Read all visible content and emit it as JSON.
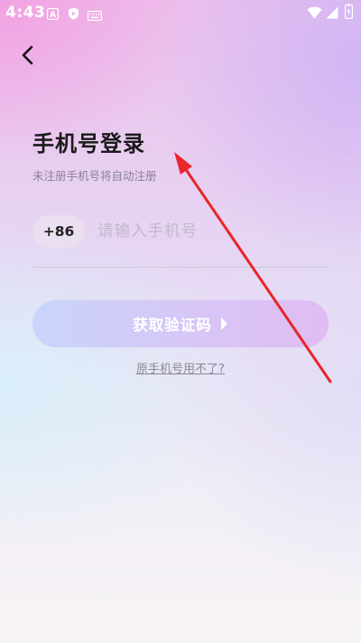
{
  "status_bar": {
    "time": "4:43",
    "icons": [
      "accessibility-a-icon",
      "play-protect-icon",
      "keyboard-icon",
      "wifi-icon",
      "signal-icon",
      "battery-charging-icon"
    ]
  },
  "header": {
    "back_icon": "chevron-left-icon"
  },
  "login": {
    "title": "手机号登录",
    "subtitle": "未注册手机号将自动注册",
    "country_code": "+86",
    "phone_placeholder": "请输入手机号",
    "phone_value": "",
    "get_code_label": "获取验证码",
    "alt_link": "原手机号用不了?"
  },
  "annotation": {
    "type": "arrow",
    "color": "#e8262b"
  },
  "colors": {
    "title": "#1a1a1a",
    "subtitle": "#8a8394",
    "button_start": "#c9d5fb",
    "button_end": "#e0bcf2"
  }
}
